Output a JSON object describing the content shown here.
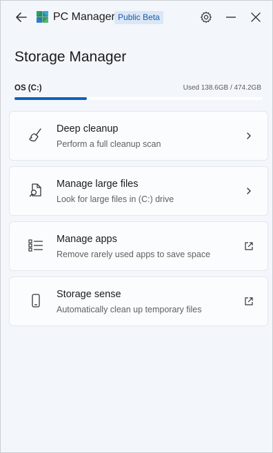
{
  "app": {
    "title": "PC Manager",
    "badge": "Public Beta"
  },
  "page": {
    "title": "Storage Manager"
  },
  "drive": {
    "label": "OS (C:)",
    "usage_text": "Used 138.6GB / 474.2GB",
    "used_gb": 138.6,
    "total_gb": 474.2,
    "used_fraction": 0.292,
    "bar_color": "#1060b8"
  },
  "cards": [
    {
      "title": "Deep cleanup",
      "subtitle": "Perform a full cleanup scan",
      "icon": "broom-icon",
      "action": "chevron-right-icon"
    },
    {
      "title": "Manage large files",
      "subtitle": "Look for large files in (C:) drive",
      "icon": "file-search-icon",
      "action": "chevron-right-icon"
    },
    {
      "title": "Manage apps",
      "subtitle": "Remove rarely used apps to save space",
      "icon": "list-icon",
      "action": "open-external-icon"
    },
    {
      "title": "Storage sense",
      "subtitle": "Automatically clean up temporary files",
      "icon": "phone-icon",
      "action": "open-external-icon"
    }
  ]
}
